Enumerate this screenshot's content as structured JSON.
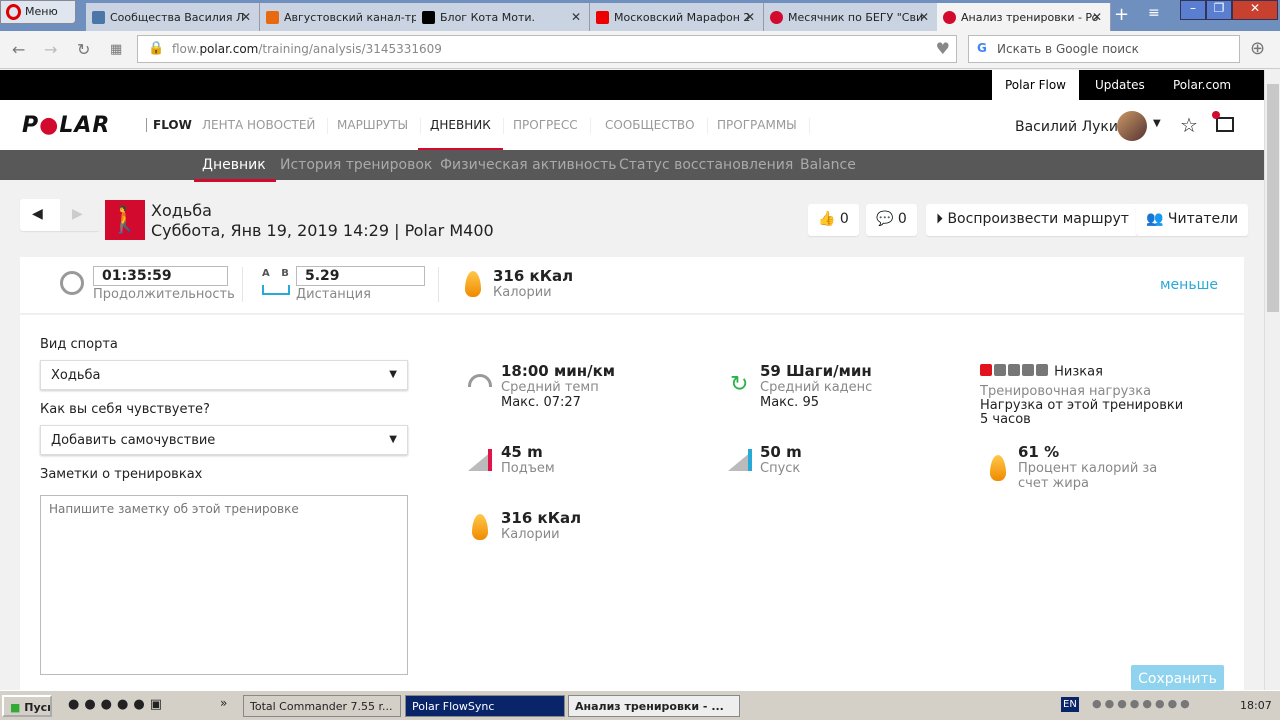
{
  "browser": {
    "menu": "Меню",
    "tabs": [
      {
        "title": "Сообщества Василия Л",
        "color": "#4a76a8"
      },
      {
        "title": "Августовский канал-тр",
        "color": "#e86a10"
      },
      {
        "title": "Блог Кота Моти.",
        "color": "#000000"
      },
      {
        "title": "Московский Марафон 2",
        "color": "#e00000"
      },
      {
        "title": "Месячник по БЕГУ \"Сви",
        "color": "#d10a2e"
      },
      {
        "title": "Анализ тренировки - Po",
        "color": "#d10a2e"
      }
    ],
    "url_prefix": "flow.",
    "url_domain": "polar.com",
    "url_path": "/training/analysis/3145331609",
    "search_placeholder": "Искать в Google поиск"
  },
  "polar_bar": [
    "Polar Flow",
    "Updates",
    "Polar.com"
  ],
  "nav": {
    "logo": "POLAR",
    "flow": "FLOW",
    "items": [
      "ЛЕНТА НОВОСТЕЙ",
      "МАРШРУТЫ",
      "ДНЕВНИК",
      "ПРОГРЕСС",
      "СООБЩЕСТВО",
      "ПРОГРАММЫ"
    ],
    "user": "Василий Лукин"
  },
  "subnav": [
    "Дневник",
    "История тренировок",
    "Физическая активность",
    "Статус восстановления",
    "Balance"
  ],
  "session": {
    "sport": "Ходьба",
    "date": "Суббота, Янв 19, 2019 14:29 | Polar M400",
    "likes": "0",
    "comments": "0",
    "replay": "Воспроизвести маршрут",
    "readers": "Читатели"
  },
  "summary": {
    "duration": "01:35:59",
    "duration_label": "Продолжительность",
    "ab": "A B",
    "distance": "5.29",
    "distance_label": "Дистанция",
    "calories": "316 кКал",
    "calories_label": "Калории",
    "less": "меньше"
  },
  "form": {
    "sport_label": "Вид спорта",
    "sport_value": "Ходьба",
    "feel_label": "Как вы себя чувствуете?",
    "feel_value": "Добавить самочувствие",
    "notes_label": "Заметки о тренировках",
    "notes_placeholder": "Напишите заметку об этой тренировке",
    "save": "Сохранить"
  },
  "stats": {
    "pace": {
      "value": "18:00 мин/км",
      "label": "Средний темп",
      "max": "Макс. 07:27"
    },
    "cadence": {
      "value": "59 Шаги/мин",
      "label": "Средний каденс",
      "max": "Макс. 95"
    },
    "load": {
      "level": "Низкая",
      "level_fraction": 0.2,
      "label": "Тренировочная нагрузка",
      "desc": "Нагрузка от этой тренировки 5 часов"
    },
    "ascent": {
      "value": "45 m",
      "label": "Подъем"
    },
    "descent": {
      "value": "50 m",
      "label": "Спуск"
    },
    "fat": {
      "value": "61 %",
      "label": "Процент калорий за счет жира"
    },
    "calories": {
      "value": "316 кКал",
      "label": "Калории"
    }
  },
  "taskbar": {
    "start": "Пуск",
    "apps": [
      "Total Commander 7.55 r...",
      "Polar FlowSync",
      "Анализ тренировки - ..."
    ],
    "lang": "EN",
    "time": "18:07"
  },
  "colors": {
    "accent": "#d10a2e",
    "link": "#29a9d8"
  }
}
